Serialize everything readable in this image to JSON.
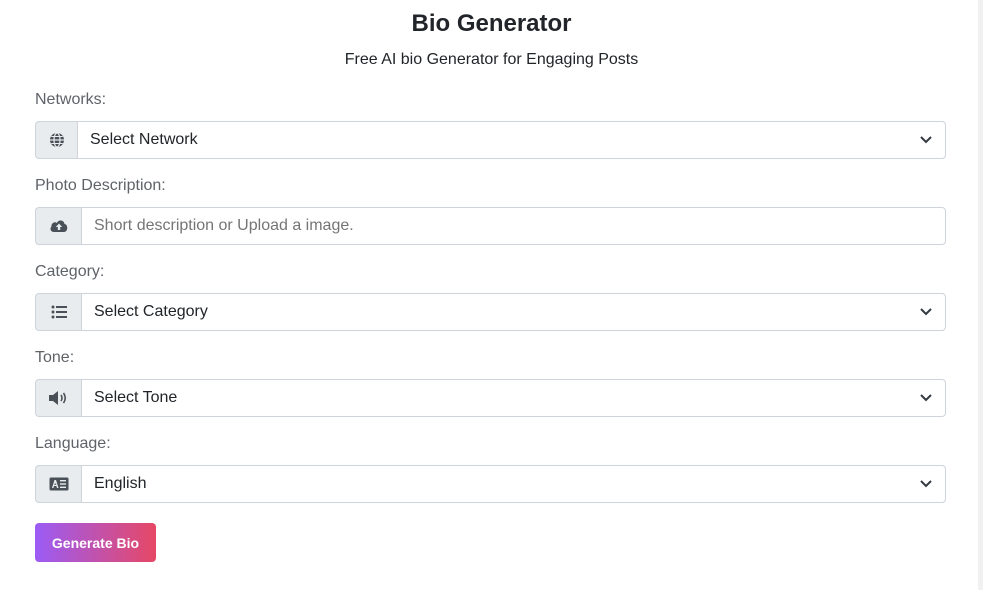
{
  "header": {
    "title": "Bio Generator",
    "subtitle": "Free AI bio Generator for Engaging Posts"
  },
  "form": {
    "network": {
      "label": "Networks:",
      "value": "Select Network",
      "icon": "globe-icon"
    },
    "photo": {
      "label": "Photo Description:",
      "placeholder": "Short description or Upload a image.",
      "value": "",
      "icon": "cloud-upload-icon"
    },
    "category": {
      "label": "Category:",
      "value": "Select Category",
      "icon": "list-icon"
    },
    "tone": {
      "label": "Tone:",
      "value": "Select Tone",
      "icon": "volume-icon"
    },
    "language": {
      "label": "Language:",
      "value": "English",
      "icon": "translate-icon"
    }
  },
  "actions": {
    "generate_label": "Generate Bio"
  },
  "colors": {
    "button_gradient_start": "#9b5cf6",
    "button_gradient_end": "#e64865",
    "addon_bg": "#e9ecef",
    "border": "#ced4da"
  }
}
